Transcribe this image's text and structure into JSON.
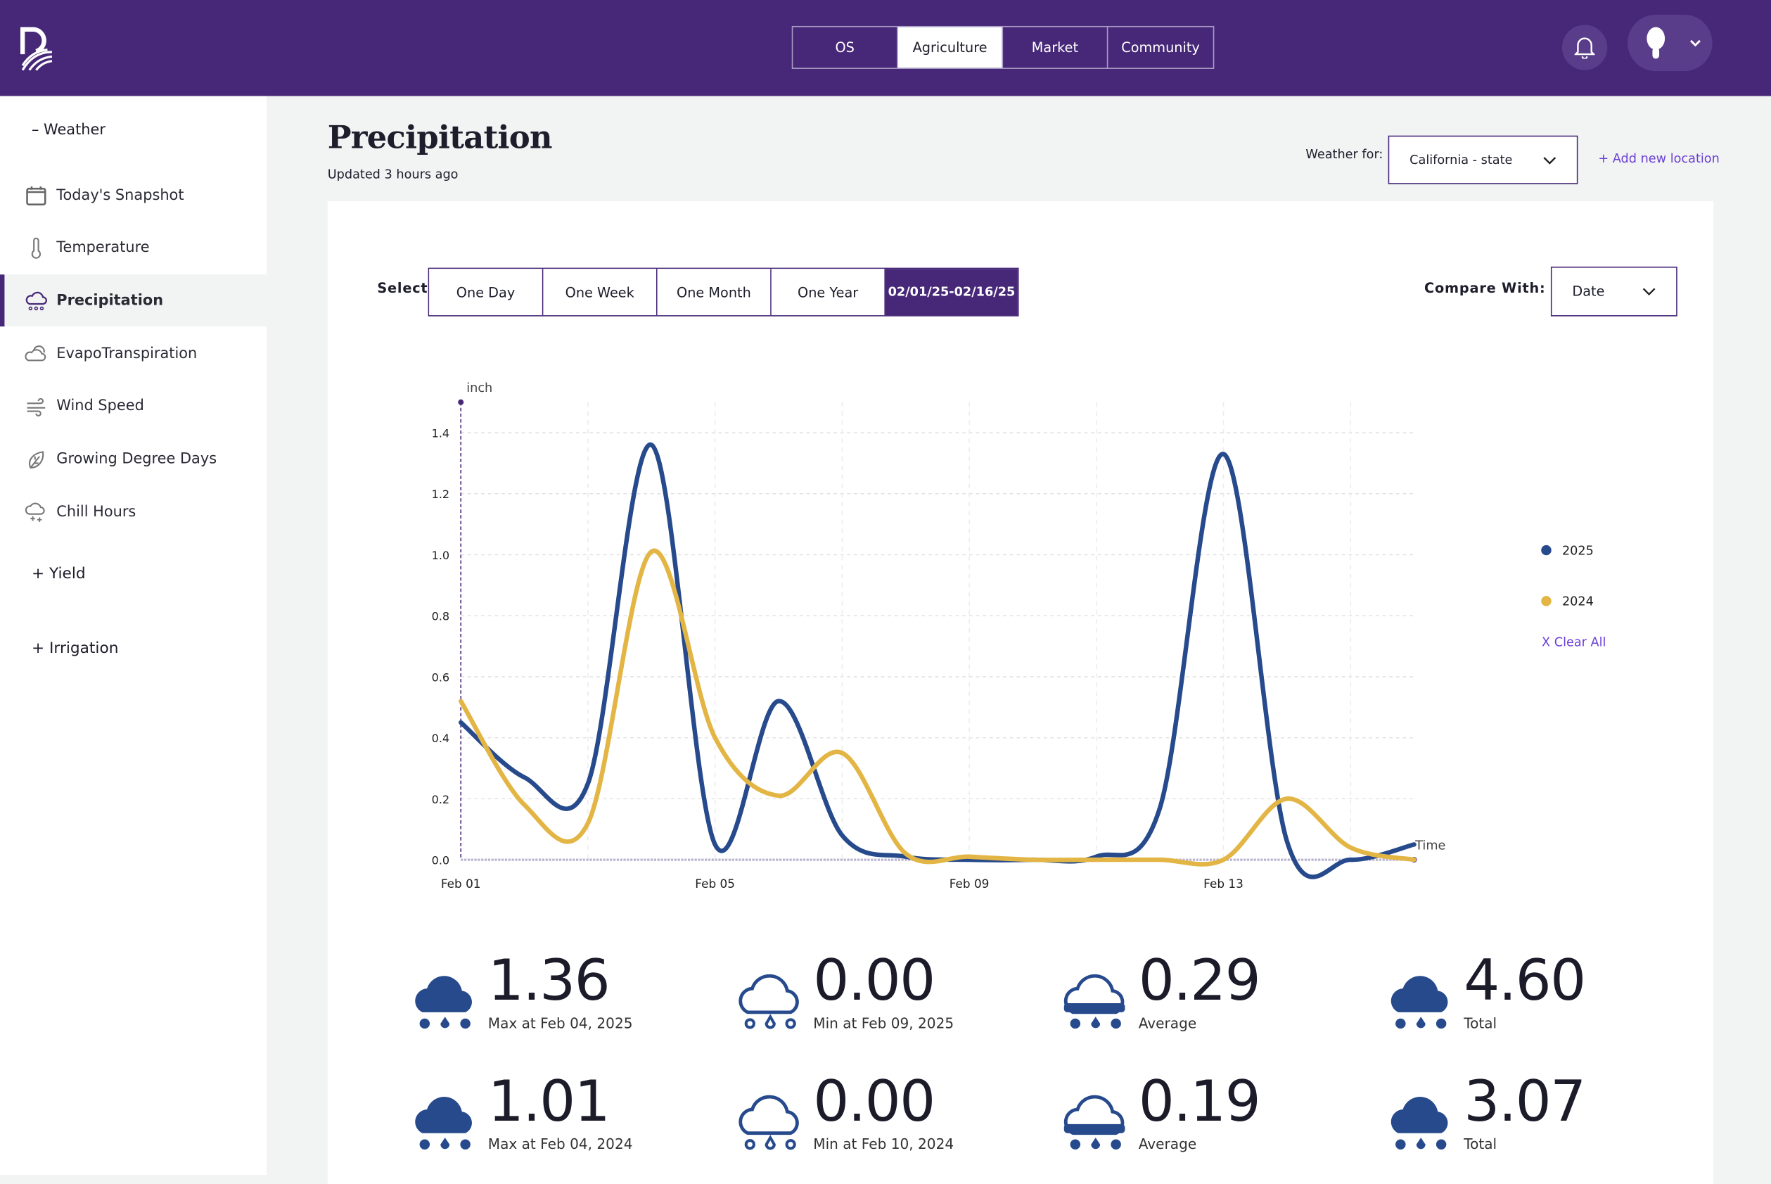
{
  "header": {
    "tabs": [
      {
        "label": "OS"
      },
      {
        "label": "Agriculture",
        "active": true
      },
      {
        "label": "Market"
      },
      {
        "label": "Community"
      }
    ],
    "brand_color": "#472878"
  },
  "sidebar": {
    "weather_group": "– Weather",
    "items": [
      {
        "label": "Today's Snapshot",
        "icon": "calendar-icon"
      },
      {
        "label": "Temperature",
        "icon": "thermometer-icon"
      },
      {
        "label": "Precipitation",
        "icon": "rain-cloud-icon",
        "active": true
      },
      {
        "label": "EvapoTranspiration",
        "icon": "clouds-icon"
      },
      {
        "label": "Wind Speed",
        "icon": "wind-icon"
      },
      {
        "label": "Growing Degree Days",
        "icon": "leaf-icon"
      },
      {
        "label": "Chill Hours",
        "icon": "snow-cloud-icon"
      }
    ],
    "yield_group": "+ Yield",
    "irrigation_group": "+ Irrigation"
  },
  "page": {
    "title": "Precipitation",
    "updated": "Updated 3 hours ago",
    "weather_for_label": "Weather for:",
    "location": "California - state",
    "add_location": "+ Add new location"
  },
  "controls": {
    "select_label": "Select",
    "ranges": [
      "One Day",
      "One Week",
      "One Month",
      "One Year",
      "02/01/25-02/16/25"
    ],
    "active_range": "02/01/25-02/16/25",
    "compare_label": "Compare With:",
    "compare_value": "Date"
  },
  "chart_data": {
    "type": "line",
    "ylabel": "inch",
    "xlabel": "Time",
    "ylim": [
      0,
      1.5
    ],
    "yticks": [
      "0.0",
      "0.2",
      "0.4",
      "0.6",
      "0.8",
      "1.0",
      "1.2",
      "1.4"
    ],
    "xticks": [
      "Feb 01",
      "Feb 05",
      "Feb 09",
      "Feb 13"
    ],
    "x": [
      "Feb 01",
      "Feb 02",
      "Feb 03",
      "Feb 04",
      "Feb 05",
      "Feb 06",
      "Feb 07",
      "Feb 08",
      "Feb 09",
      "Feb 10",
      "Feb 11",
      "Feb 12",
      "Feb 13",
      "Feb 14",
      "Feb 15",
      "Feb 16"
    ],
    "series": [
      {
        "name": "2025",
        "color": "#264a8c",
        "values": [
          0.45,
          0.27,
          0.25,
          1.36,
          0.05,
          0.52,
          0.08,
          0.01,
          0.0,
          0.0,
          0.01,
          0.17,
          1.33,
          0.06,
          0.0,
          0.05
        ]
      },
      {
        "name": "2024",
        "color": "#e3b544",
        "values": [
          0.52,
          0.18,
          0.12,
          1.01,
          0.4,
          0.21,
          0.35,
          0.02,
          0.01,
          0.0,
          0.0,
          0.0,
          0.0,
          0.2,
          0.04,
          0.0
        ]
      }
    ],
    "grid": true,
    "legend": "right",
    "clear_all": "X Clear All"
  },
  "stats": [
    [
      {
        "value": "1.36",
        "label": "Max at Feb 04, 2025",
        "icon": "max"
      },
      {
        "value": "0.00",
        "label": "Min at Feb 09, 2025",
        "icon": "min"
      },
      {
        "value": "0.29",
        "label": "Average",
        "icon": "avg"
      },
      {
        "value": "4.60",
        "label": "Total",
        "icon": "max"
      }
    ],
    [
      {
        "value": "1.01",
        "label": "Max at Feb 04, 2024",
        "icon": "max"
      },
      {
        "value": "0.00",
        "label": "Min at Feb 10, 2024",
        "icon": "min"
      },
      {
        "value": "0.19",
        "label": "Average",
        "icon": "avg"
      },
      {
        "value": "3.07",
        "label": "Total",
        "icon": "max"
      }
    ]
  ]
}
